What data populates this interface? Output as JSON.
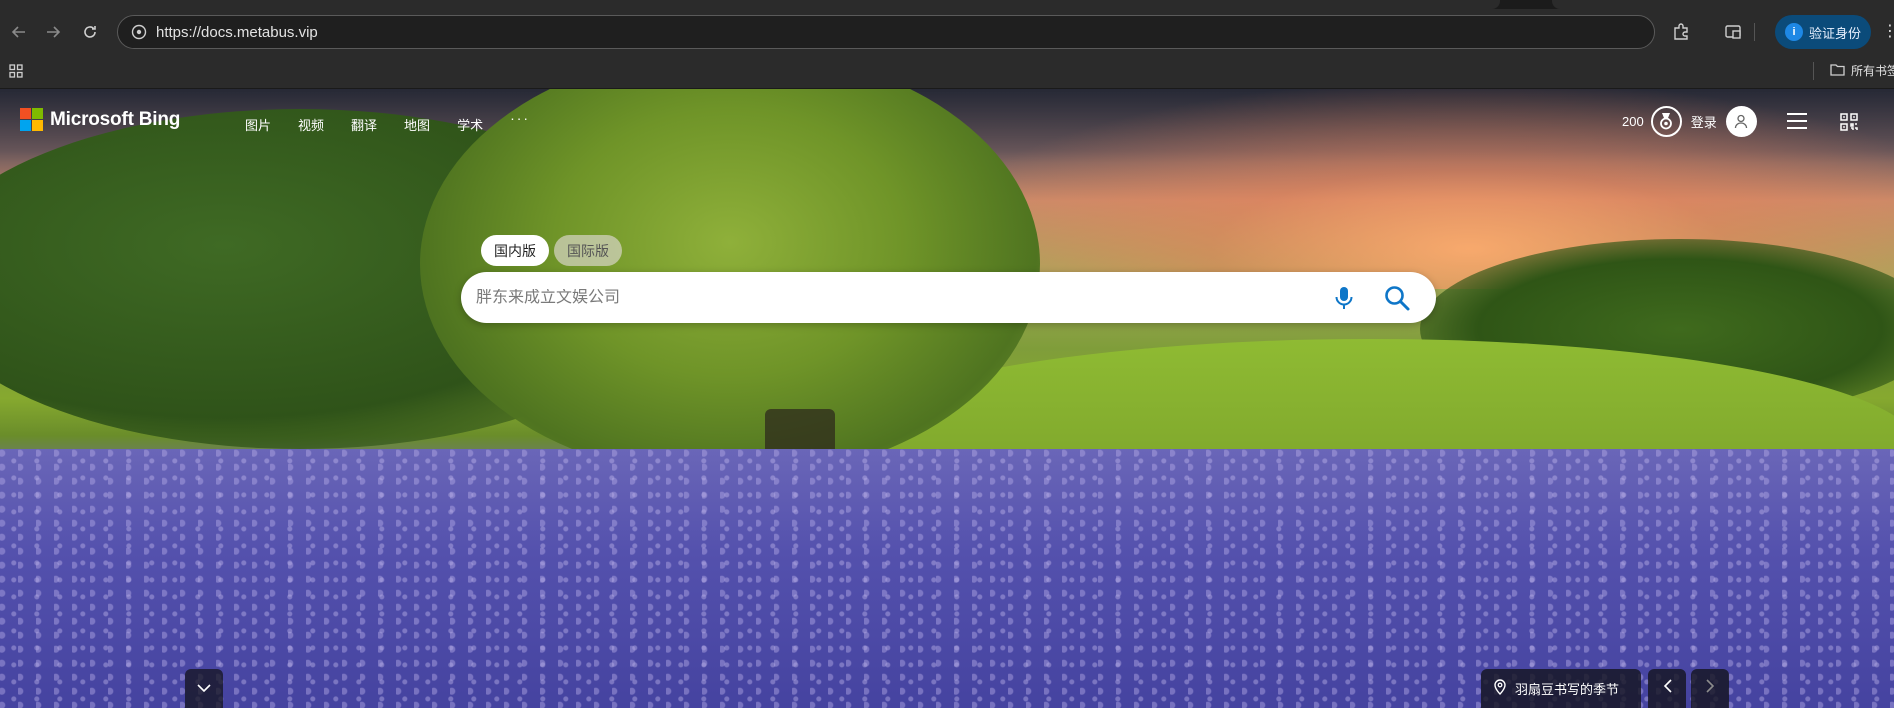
{
  "browser": {
    "url": "https://docs.metabus.vip",
    "verify_label": "验证身份",
    "all_bookmarks_label": "所有书签",
    "icons": [
      "back-icon",
      "forward-icon",
      "reload-icon",
      "site-info-icon",
      "extensions-icon",
      "split-screen-icon",
      "apps-grid-icon",
      "folder-icon"
    ]
  },
  "bing": {
    "brand": "Microsoft Bing",
    "nav": [
      "图片",
      "视频",
      "翻译",
      "地图",
      "学术"
    ],
    "more": "···",
    "points": "200",
    "signin_label": "登录",
    "scope_tabs": [
      "国内版",
      "国际版"
    ],
    "active_scope": "国内版",
    "search_placeholder": "胖东来成立文娱公司",
    "caption": "羽扇豆书写的季节",
    "colors": {
      "search_icon": "#0e76c8",
      "ms_red": "#f25022",
      "ms_green": "#7fba00",
      "ms_blue": "#00a4ef",
      "ms_yellow": "#ffb900"
    }
  }
}
